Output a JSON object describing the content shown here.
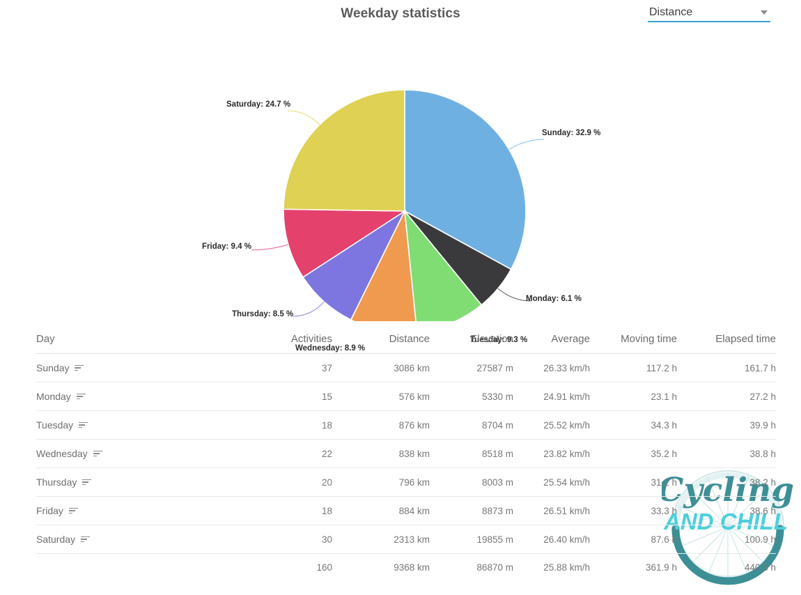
{
  "header": {
    "title": "Weekday statistics",
    "metric_select": {
      "value": "Distance",
      "caret_icon": "chevron-down-icon"
    }
  },
  "colors": {
    "accent": "#3f9fd6",
    "sunday": "#6fb0e3",
    "monday": "#3a3a3c",
    "tuesday": "#80dd73",
    "wednesday": "#f09a4f",
    "thursday": "#7d76e0",
    "friday": "#e5416d",
    "saturday": "#ded153",
    "watermark_dark": "#3d8f96",
    "watermark_light": "#4ccfdb"
  },
  "chart_data": {
    "type": "pie",
    "title": "Weekday statistics",
    "metric": "Distance",
    "unit": "%",
    "legend_position": "callout-labels",
    "categories": [
      "Sunday",
      "Monday",
      "Tuesday",
      "Wednesday",
      "Thursday",
      "Friday",
      "Saturday"
    ],
    "values": [
      32.9,
      6.1,
      9.3,
      8.9,
      8.5,
      9.4,
      24.7
    ],
    "labels": [
      "Sunday: 32.9 %",
      "Monday: 6.1 %",
      "Tuesday: 9.3 %",
      "Wednesday: 8.9 %",
      "Thursday: 8.5 %",
      "Friday: 9.4 %",
      "Saturday: 24.7 %"
    ],
    "colors": [
      "#6fb0e3",
      "#3a3a3c",
      "#80dd73",
      "#f09a4f",
      "#7d76e0",
      "#e5416d",
      "#ded153"
    ]
  },
  "table": {
    "columns": [
      "Day",
      "Activities",
      "Distance",
      "Elevation",
      "Average",
      "Moving time",
      "Elapsed time"
    ],
    "filter_icon": "filter-icon",
    "rows": [
      {
        "day": "Sunday",
        "activities": "37",
        "distance": "3086 km",
        "elevation": "27587 m",
        "average": "26.33 km/h",
        "moving": "117.2 h",
        "elapsed": "161.7 h"
      },
      {
        "day": "Monday",
        "activities": "15",
        "distance": "576 km",
        "elevation": "5330 m",
        "average": "24.91 km/h",
        "moving": "23.1 h",
        "elapsed": "27.2 h"
      },
      {
        "day": "Tuesday",
        "activities": "18",
        "distance": "876 km",
        "elevation": "8704 m",
        "average": "25.52 km/h",
        "moving": "34.3 h",
        "elapsed": "39.9 h"
      },
      {
        "day": "Wednesday",
        "activities": "22",
        "distance": "838 km",
        "elevation": "8518 m",
        "average": "23.82 km/h",
        "moving": "35.2 h",
        "elapsed": "38.8 h"
      },
      {
        "day": "Thursday",
        "activities": "20",
        "distance": "796 km",
        "elevation": "8003 m",
        "average": "25.54 km/h",
        "moving": "31.2 h",
        "elapsed": "38.2 h"
      },
      {
        "day": "Friday",
        "activities": "18",
        "distance": "884 km",
        "elevation": "8873 m",
        "average": "26.51 km/h",
        "moving": "33.3 h",
        "elapsed": "38.6 h"
      },
      {
        "day": "Saturday",
        "activities": "30",
        "distance": "2313 km",
        "elevation": "19855 m",
        "average": "26.40 km/h",
        "moving": "87.6 h",
        "elapsed": "100.9 h"
      }
    ],
    "total": {
      "day": "",
      "activities": "160",
      "distance": "9368 km",
      "elevation": "86870 m",
      "average": "25.88 km/h",
      "moving": "361.9 h",
      "elapsed": "440.3 h"
    }
  },
  "watermark": {
    "line1": "Cycling",
    "line2": "AND CHILL",
    "icon": "bicycle-wheel-icon"
  }
}
